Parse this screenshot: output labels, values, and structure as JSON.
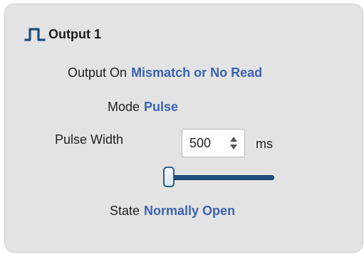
{
  "header": {
    "icon": "pulse-waveform-icon",
    "title": "Output 1"
  },
  "output_on": {
    "label": "Output On",
    "value": "Mismatch or No Read"
  },
  "mode": {
    "label": "Mode",
    "value": "Pulse"
  },
  "pulse_width": {
    "label": "Pulse Width",
    "value": "500",
    "unit": "ms",
    "slider_fraction": 0.0
  },
  "state": {
    "label": "State",
    "value": "Normally Open"
  },
  "colors": {
    "accent": "#3a63b2",
    "icon": "#1d4f7d",
    "panel_bg": "#e3e3e3"
  }
}
